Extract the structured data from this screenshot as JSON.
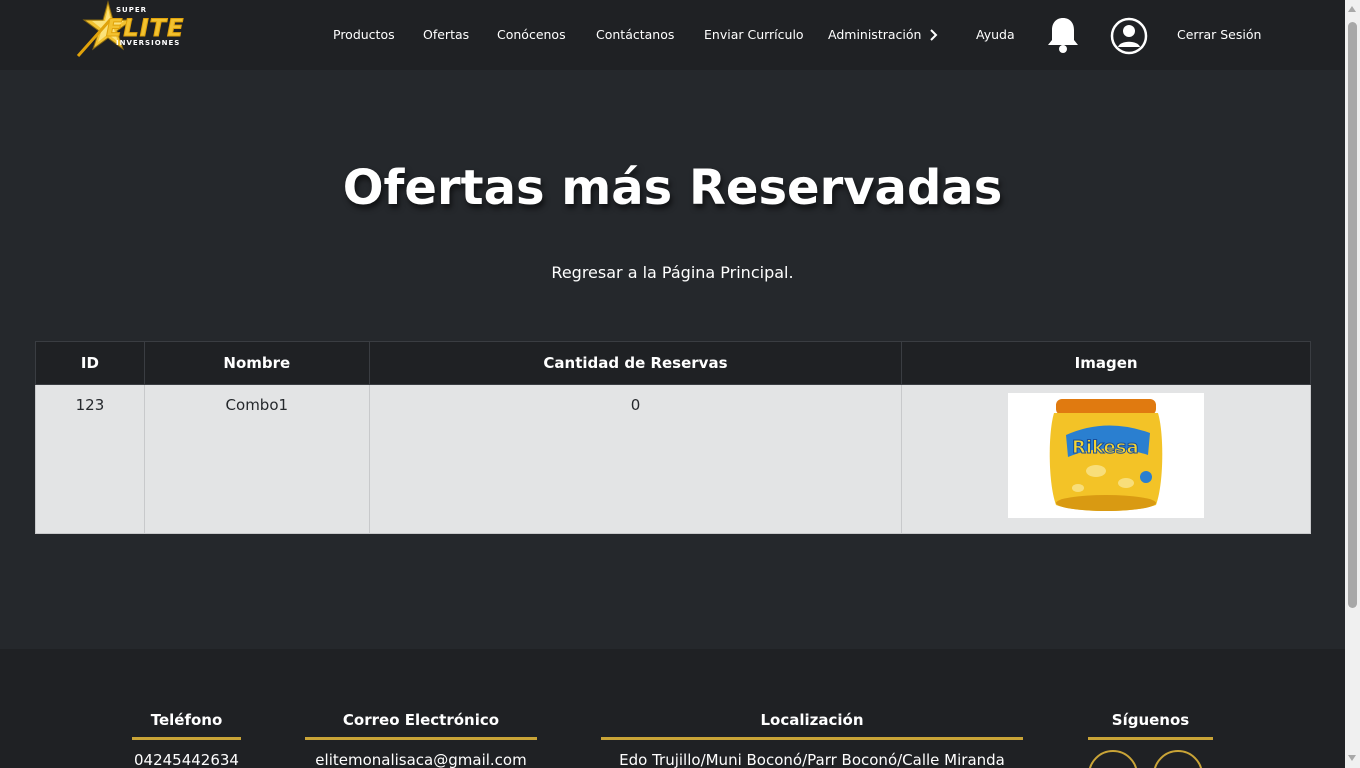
{
  "brand": {
    "top": "SUPER",
    "name": "ELITE",
    "bottom": "INVERSIONES",
    "accent_color": "#f2c230"
  },
  "nav": {
    "items": [
      "Productos",
      "Ofertas",
      "Conócenos",
      "Contáctanos",
      "Enviar Currículo",
      "Administración",
      "Ayuda",
      "Cerrar Sesión"
    ],
    "icons": [
      "chevron-right-icon",
      "bell-icon",
      "user-icon"
    ]
  },
  "main": {
    "title": "Ofertas más Reservadas",
    "back_link": "Regresar a la Página Principal."
  },
  "table": {
    "headers": [
      "ID",
      "Nombre",
      "Cantidad de Reservas",
      "Imagen"
    ],
    "rows": [
      {
        "id": "123",
        "nombre": "Combo1",
        "cantidad": "0",
        "image_text": "Rikesa"
      }
    ]
  },
  "footer": {
    "phone_title": "Teléfono",
    "phone": "04245442634",
    "email_title": "Correo Electrónico",
    "email": "elitemonalisaca@gmail.com",
    "location_title": "Localización",
    "location": "Edo Trujillo/Muni Boconó/Parr Boconó/Calle Miranda",
    "social_title": "Síguenos",
    "social_icons": [
      "tiktok-icon",
      "instagram-icon"
    ]
  },
  "colors": {
    "background": "#25282c",
    "header": "#1f2124",
    "table_row": "#e3e4e5",
    "footer_accent": "#c9a437"
  }
}
